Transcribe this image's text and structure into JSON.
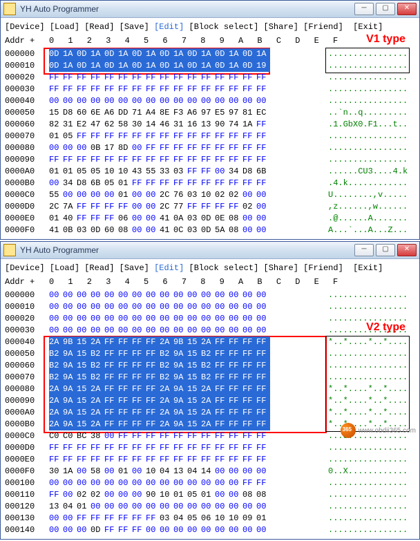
{
  "window_title": "YH Auto Programmer",
  "menu": {
    "device": "[Device]",
    "load": "[Load]",
    "read": "[Read]",
    "save": "[Save]",
    "edit": "[Edit]",
    "block": "[Block select]",
    "share": "[Share]",
    "friend": "[Friend]",
    "exit": "[Exit]"
  },
  "addr_label": "Addr +",
  "hex_header": [
    "0",
    "1",
    "2",
    "3",
    "4",
    "5",
    "6",
    "7",
    "8",
    "9",
    "A",
    "B",
    "C",
    "D",
    "E",
    "F"
  ],
  "label_v1": "V1 type",
  "label_v2": "V2 type",
  "watermark": "www.obdii365.com",
  "win1_rows": [
    {
      "addr": "000000",
      "bytes": [
        "0D",
        "1A",
        "0D",
        "1A",
        "0D",
        "1A",
        "0D",
        "1A",
        "0D",
        "1A",
        "0D",
        "1A",
        "0D",
        "1A",
        "0D",
        "1A"
      ],
      "ascii": "................",
      "sel": [
        0,
        15
      ]
    },
    {
      "addr": "000010",
      "bytes": [
        "0D",
        "1A",
        "0D",
        "1A",
        "0D",
        "1A",
        "0D",
        "1A",
        "0D",
        "1A",
        "0D",
        "1A",
        "0D",
        "1A",
        "0D",
        "19"
      ],
      "ascii": "................",
      "sel": [
        0,
        15
      ],
      "last": true
    },
    {
      "addr": "000020",
      "bytes": [
        "FF",
        "FF",
        "FF",
        "FF",
        "FF",
        "FF",
        "FF",
        "FF",
        "FF",
        "FF",
        "FF",
        "FF",
        "FF",
        "FF",
        "FF",
        "FF"
      ],
      "ascii": "................"
    },
    {
      "addr": "000030",
      "bytes": [
        "FF",
        "FF",
        "FF",
        "FF",
        "FF",
        "FF",
        "FF",
        "FF",
        "FF",
        "FF",
        "FF",
        "FF",
        "FF",
        "FF",
        "FF",
        "FF"
      ],
      "ascii": "................"
    },
    {
      "addr": "000040",
      "bytes": [
        "00",
        "00",
        "00",
        "00",
        "00",
        "00",
        "00",
        "00",
        "00",
        "00",
        "00",
        "00",
        "00",
        "00",
        "00",
        "00"
      ],
      "ascii": "................"
    },
    {
      "addr": "000050",
      "bytes": [
        "15",
        "D8",
        "60",
        "6E",
        "A6",
        "DD",
        "71",
        "A4",
        "8E",
        "F3",
        "A6",
        "97",
        "E5",
        "97",
        "81",
        "EC"
      ],
      "ascii": "..`n..q........."
    },
    {
      "addr": "000060",
      "bytes": [
        "82",
        "31",
        "E2",
        "47",
        "62",
        "58",
        "30",
        "14",
        "46",
        "31",
        "16",
        "13",
        "90",
        "74",
        "1A",
        "FF"
      ],
      "ascii": ".1.GbX0.F1...t.."
    },
    {
      "addr": "000070",
      "bytes": [
        "01",
        "05",
        "FF",
        "FF",
        "FF",
        "FF",
        "FF",
        "FF",
        "FF",
        "FF",
        "FF",
        "FF",
        "FF",
        "FF",
        "FF",
        "FF"
      ],
      "ascii": "................"
    },
    {
      "addr": "000080",
      "bytes": [
        "00",
        "00",
        "00",
        "0B",
        "17",
        "8D",
        "00",
        "FF",
        "FF",
        "FF",
        "FF",
        "FF",
        "FF",
        "FF",
        "FF",
        "FF"
      ],
      "ascii": "................"
    },
    {
      "addr": "000090",
      "bytes": [
        "FF",
        "FF",
        "FF",
        "FF",
        "FF",
        "FF",
        "FF",
        "FF",
        "FF",
        "FF",
        "FF",
        "FF",
        "FF",
        "FF",
        "FF",
        "FF"
      ],
      "ascii": "................"
    },
    {
      "addr": "0000A0",
      "bytes": [
        "01",
        "01",
        "05",
        "05",
        "10",
        "10",
        "43",
        "55",
        "33",
        "03",
        "FF",
        "FF",
        "00",
        "34",
        "D8",
        "6B"
      ],
      "ascii": "......CU3....4.k"
    },
    {
      "addr": "0000B0",
      "bytes": [
        "00",
        "34",
        "D8",
        "6B",
        "05",
        "01",
        "FF",
        "FF",
        "FF",
        "FF",
        "FF",
        "FF",
        "FF",
        "FF",
        "FF",
        "FF"
      ],
      "ascii": ".4.k............"
    },
    {
      "addr": "0000C0",
      "bytes": [
        "55",
        "00",
        "00",
        "00",
        "00",
        "01",
        "00",
        "00",
        "2C",
        "76",
        "03",
        "10",
        "02",
        "02",
        "00",
        "00"
      ],
      "ascii": "U........,v....."
    },
    {
      "addr": "0000D0",
      "bytes": [
        "2C",
        "7A",
        "FF",
        "FF",
        "FF",
        "FF",
        "00",
        "00",
        "2C",
        "77",
        "FF",
        "FF",
        "FF",
        "FF",
        "02",
        "00"
      ],
      "ascii": ",z......,w......"
    },
    {
      "addr": "0000E0",
      "bytes": [
        "01",
        "40",
        "FF",
        "FF",
        "FF",
        "06",
        "00",
        "00",
        "41",
        "0A",
        "03",
        "0D",
        "0E",
        "08",
        "00",
        "00"
      ],
      "ascii": ".@......A......."
    },
    {
      "addr": "0000F0",
      "bytes": [
        "41",
        "0B",
        "03",
        "0D",
        "60",
        "08",
        "00",
        "00",
        "41",
        "0C",
        "03",
        "0D",
        "5A",
        "08",
        "00",
        "00"
      ],
      "ascii": "A...`...A...Z..."
    }
  ],
  "win2_rows": [
    {
      "addr": "000000",
      "bytes": [
        "00",
        "00",
        "00",
        "00",
        "00",
        "00",
        "00",
        "00",
        "00",
        "00",
        "00",
        "00",
        "00",
        "00",
        "00",
        "00"
      ],
      "ascii": "................"
    },
    {
      "addr": "000010",
      "bytes": [
        "00",
        "00",
        "00",
        "00",
        "00",
        "00",
        "00",
        "00",
        "00",
        "00",
        "00",
        "00",
        "00",
        "00",
        "00",
        "00"
      ],
      "ascii": "................"
    },
    {
      "addr": "000020",
      "bytes": [
        "00",
        "00",
        "00",
        "00",
        "00",
        "00",
        "00",
        "00",
        "00",
        "00",
        "00",
        "00",
        "00",
        "00",
        "00",
        "00"
      ],
      "ascii": "................"
    },
    {
      "addr": "000030",
      "bytes": [
        "00",
        "00",
        "00",
        "00",
        "00",
        "00",
        "00",
        "00",
        "00",
        "00",
        "00",
        "00",
        "00",
        "00",
        "00",
        "00"
      ],
      "ascii": "................"
    },
    {
      "addr": "000040",
      "bytes": [
        "2A",
        "9B",
        "15",
        "2A",
        "FF",
        "FF",
        "FF",
        "FF",
        "2A",
        "9B",
        "15",
        "2A",
        "FF",
        "FF",
        "FF",
        "FF"
      ],
      "ascii": "*..*....*..*....",
      "sel": [
        0,
        15
      ]
    },
    {
      "addr": "000050",
      "bytes": [
        "B2",
        "9A",
        "15",
        "B2",
        "FF",
        "FF",
        "FF",
        "FF",
        "B2",
        "9A",
        "15",
        "B2",
        "FF",
        "FF",
        "FF",
        "FF"
      ],
      "ascii": "................",
      "sel": [
        0,
        15
      ]
    },
    {
      "addr": "000060",
      "bytes": [
        "B2",
        "9A",
        "15",
        "B2",
        "FF",
        "FF",
        "FF",
        "FF",
        "B2",
        "9A",
        "15",
        "B2",
        "FF",
        "FF",
        "FF",
        "FF"
      ],
      "ascii": "................",
      "sel": [
        0,
        15
      ]
    },
    {
      "addr": "000070",
      "bytes": [
        "B2",
        "9A",
        "15",
        "B2",
        "FF",
        "FF",
        "FF",
        "FF",
        "B2",
        "9A",
        "15",
        "B2",
        "FF",
        "FF",
        "FF",
        "FF"
      ],
      "ascii": "................",
      "sel": [
        0,
        15
      ]
    },
    {
      "addr": "000080",
      "bytes": [
        "2A",
        "9A",
        "15",
        "2A",
        "FF",
        "FF",
        "FF",
        "FF",
        "2A",
        "9A",
        "15",
        "2A",
        "FF",
        "FF",
        "FF",
        "FF"
      ],
      "ascii": "*..*....*..*....",
      "sel": [
        0,
        15
      ]
    },
    {
      "addr": "000090",
      "bytes": [
        "2A",
        "9A",
        "15",
        "2A",
        "FF",
        "FF",
        "FF",
        "FF",
        "2A",
        "9A",
        "15",
        "2A",
        "FF",
        "FF",
        "FF",
        "FF"
      ],
      "ascii": "*..*....*..*....",
      "sel": [
        0,
        15
      ]
    },
    {
      "addr": "0000A0",
      "bytes": [
        "2A",
        "9A",
        "15",
        "2A",
        "FF",
        "FF",
        "FF",
        "FF",
        "2A",
        "9A",
        "15",
        "2A",
        "FF",
        "FF",
        "FF",
        "FF"
      ],
      "ascii": "*..*....*..*....",
      "sel": [
        0,
        15
      ]
    },
    {
      "addr": "0000B0",
      "bytes": [
        "2A",
        "9A",
        "15",
        "2A",
        "FF",
        "FF",
        "FF",
        "FF",
        "2A",
        "9A",
        "15",
        "2A",
        "FF",
        "FF",
        "FF",
        "FF"
      ],
      "ascii": "*..*....*..*....",
      "sel": [
        0,
        15
      ],
      "last": true
    },
    {
      "addr": "0000C0",
      "bytes": [
        "C0",
        "C0",
        "BC",
        "38",
        "00",
        "FF",
        "FF",
        "FF",
        "FF",
        "FF",
        "FF",
        "FF",
        "FF",
        "FF",
        "FF",
        "FF"
      ],
      "ascii": "...8............"
    },
    {
      "addr": "0000D0",
      "bytes": [
        "FF",
        "FF",
        "FF",
        "FF",
        "FF",
        "FF",
        "FF",
        "FF",
        "FF",
        "FF",
        "FF",
        "FF",
        "FF",
        "FF",
        "FF",
        "FF"
      ],
      "ascii": "................"
    },
    {
      "addr": "0000E0",
      "bytes": [
        "FF",
        "FF",
        "FF",
        "FF",
        "FF",
        "FF",
        "FF",
        "FF",
        "FF",
        "FF",
        "FF",
        "FF",
        "FF",
        "FF",
        "FF",
        "FF"
      ],
      "ascii": "................"
    },
    {
      "addr": "0000F0",
      "bytes": [
        "30",
        "1A",
        "00",
        "58",
        "00",
        "01",
        "00",
        "10",
        "04",
        "13",
        "04",
        "14",
        "00",
        "00",
        "00",
        "00"
      ],
      "ascii": "0..X............"
    },
    {
      "addr": "000100",
      "bytes": [
        "00",
        "00",
        "00",
        "00",
        "00",
        "00",
        "00",
        "00",
        "00",
        "00",
        "00",
        "00",
        "00",
        "00",
        "FF",
        "FF"
      ],
      "ascii": "................"
    },
    {
      "addr": "000110",
      "bytes": [
        "FF",
        "00",
        "02",
        "02",
        "00",
        "00",
        "00",
        "90",
        "10",
        "01",
        "05",
        "01",
        "00",
        "00",
        "08",
        "08"
      ],
      "ascii": "................"
    },
    {
      "addr": "000120",
      "bytes": [
        "13",
        "04",
        "01",
        "00",
        "00",
        "00",
        "00",
        "00",
        "00",
        "00",
        "00",
        "00",
        "00",
        "00",
        "00",
        "00"
      ],
      "ascii": "................"
    },
    {
      "addr": "000130",
      "bytes": [
        "00",
        "00",
        "FF",
        "FF",
        "FF",
        "FF",
        "FF",
        "FF",
        "03",
        "04",
        "05",
        "06",
        "10",
        "10",
        "09",
        "01"
      ],
      "ascii": "................"
    },
    {
      "addr": "000140",
      "bytes": [
        "00",
        "00",
        "00",
        "0D",
        "FF",
        "FF",
        "FF",
        "00",
        "00",
        "00",
        "00",
        "00",
        "00",
        "00",
        "00",
        "00"
      ],
      "ascii": "................"
    }
  ]
}
